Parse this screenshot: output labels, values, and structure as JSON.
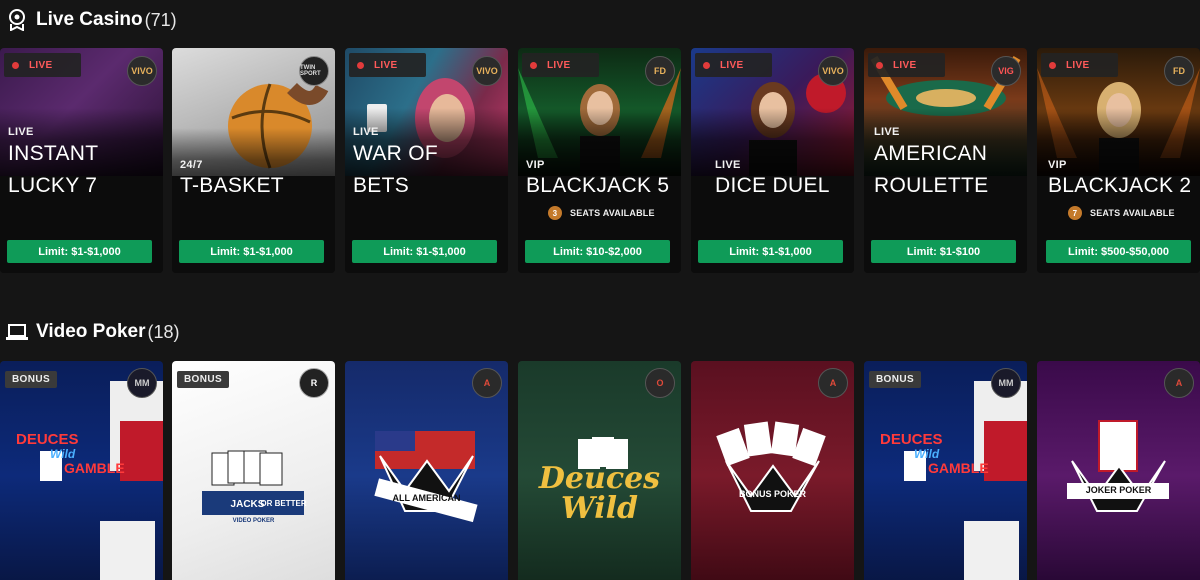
{
  "live_section": {
    "title": "Live Casino",
    "count": "(71)",
    "icon": "casino-chip-icon",
    "cards": [
      {
        "badge": "LIVE",
        "provider": "VIVO",
        "tag": "LIVE",
        "name_lines": [
          "INSTANT",
          "LUCKY 7"
        ],
        "limit": "Limit: $1-$1,000",
        "seats": null,
        "has_badge": true
      },
      {
        "badge": "",
        "provider": "TWIN SPORT",
        "tag": "24/7",
        "name_lines": [
          "",
          "T-BASKET"
        ],
        "limit": "Limit: $1-$1,000",
        "seats": null,
        "has_badge": false
      },
      {
        "badge": "LIVE",
        "provider": "VIVO",
        "tag": "LIVE",
        "name_lines": [
          "WAR OF",
          "BETS"
        ],
        "limit": "Limit: $1-$1,000",
        "seats": null,
        "has_badge": true
      },
      {
        "badge": "LIVE",
        "provider": "FD",
        "tag": "VIP",
        "name_lines": [
          "",
          "BLACKJACK 5"
        ],
        "limit": "Limit: $10-$2,000",
        "seats": {
          "num": "3",
          "text": "SEATS AVAILABLE"
        },
        "has_badge": true
      },
      {
        "badge": "LIVE",
        "provider": "VIVO",
        "tag": "LIVE",
        "name_lines": [
          "",
          "DICE DUEL"
        ],
        "limit": "Limit: $1-$1,000",
        "seats": null,
        "has_badge": true
      },
      {
        "badge": "LIVE",
        "provider": "VIG",
        "tag": "LIVE",
        "name_lines": [
          "AMERICAN",
          "ROULETTE"
        ],
        "limit": "Limit: $1-$100",
        "seats": null,
        "has_badge": true
      },
      {
        "badge": "LIVE",
        "provider": "FD",
        "tag": "VIP",
        "name_lines": [
          "",
          "BLACKJACK 2"
        ],
        "limit": "Limit: $500-$50,000",
        "seats": {
          "num": "7",
          "text": "SEATS AVAILABLE"
        },
        "has_badge": true
      }
    ]
  },
  "poker_section": {
    "title": "Video Poker",
    "count": "(18)",
    "icon": "laptop-icon",
    "cards": [
      {
        "badge": "BONUS",
        "title_lines": [
          "DEUCES",
          "Wild",
          "GAMBLE"
        ],
        "provider": "MM"
      },
      {
        "badge": "BONUS",
        "title_lines": [
          "JACKS",
          "OR BETTER",
          "VIDEO POKER"
        ],
        "provider": "R"
      },
      {
        "badge": "",
        "title_lines": [
          "ALL AMERICAN"
        ],
        "provider": "A"
      },
      {
        "badge": "",
        "title_lines": [
          "Deuces",
          "Wild"
        ],
        "provider": "O"
      },
      {
        "badge": "",
        "title_lines": [
          "BONUS POKER"
        ],
        "provider": "A"
      },
      {
        "badge": "BONUS",
        "title_lines": [
          "DEUCES",
          "Wild",
          "GAMBLE"
        ],
        "provider": "MM"
      },
      {
        "badge": "",
        "title_lines": [
          "JOKER POKER"
        ],
        "provider": "A"
      }
    ]
  },
  "colors": {
    "background": "#151515",
    "limit_green": "#0f9b58",
    "live_red": "#e23b3b",
    "seat_orange": "#c47a2b"
  }
}
